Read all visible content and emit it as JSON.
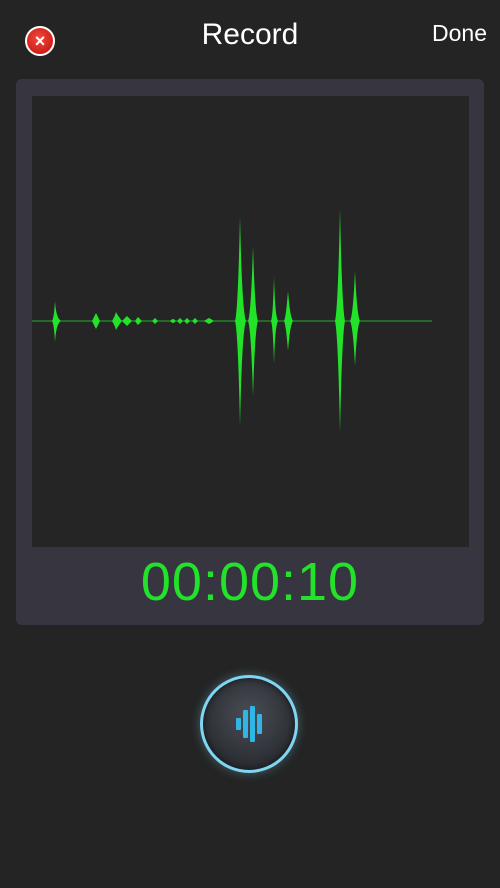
{
  "header": {
    "title": "Record",
    "done_label": "Done",
    "cancel_icon_glyph": "×"
  },
  "timer": {
    "elapsed": "00:00:10"
  },
  "record_button": {
    "icon": "waveform-bars-icon"
  },
  "colors": {
    "waveform": "#22e22a",
    "timer": "#22e22a",
    "cancel": "#d9261c",
    "record_ring": "#7fd6f2",
    "record_icon": "#2fb6e6"
  }
}
